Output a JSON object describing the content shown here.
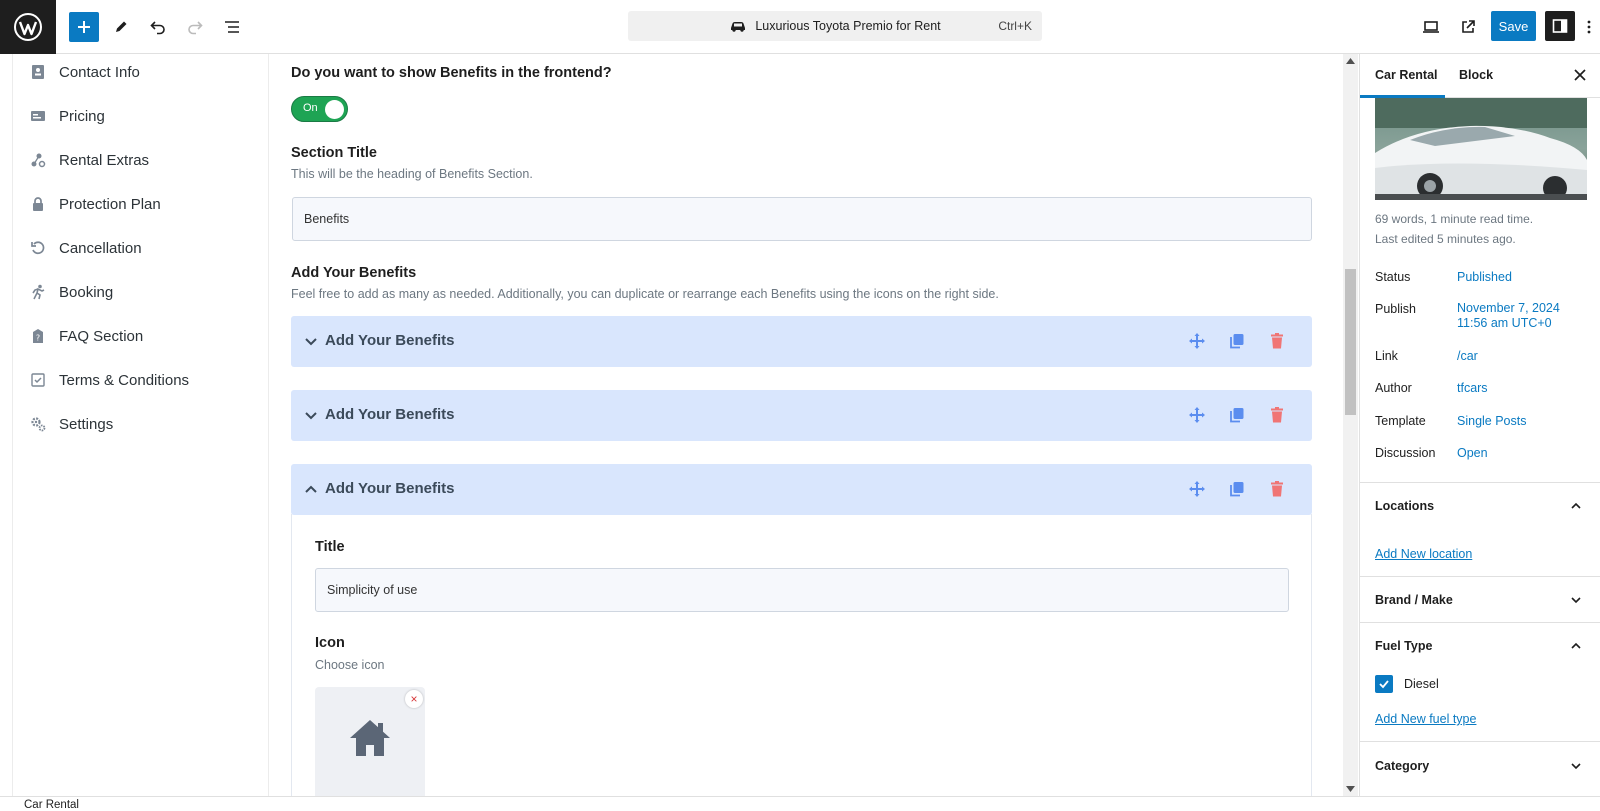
{
  "topbar": {
    "document_title": "Luxurious Toyota Premio for Rent",
    "shortcut": "Ctrl+K",
    "save_label": "Save"
  },
  "leftnav": {
    "items": [
      {
        "label": "Contact Info",
        "icon": "contact-card-icon"
      },
      {
        "label": "Pricing",
        "icon": "price-card-icon"
      },
      {
        "label": "Rental Extras",
        "icon": "extras-icon"
      },
      {
        "label": "Protection Plan",
        "icon": "lock-icon"
      },
      {
        "label": "Cancellation",
        "icon": "undo-icon"
      },
      {
        "label": "Booking",
        "icon": "booking-runner-icon"
      },
      {
        "label": "FAQ Section",
        "icon": "faq-icon"
      },
      {
        "label": "Terms & Conditions",
        "icon": "checklist-icon"
      },
      {
        "label": "Settings",
        "icon": "gears-icon"
      }
    ]
  },
  "main": {
    "show_question": "Do you want to show Benefits in the frontend?",
    "toggle_label": "On",
    "toggle_on": true,
    "section_title_label": "Section Title",
    "section_title_desc": "This will be the heading of Benefits Section.",
    "section_title_value": "Benefits",
    "benefits_label": "Add Your Benefits",
    "benefits_desc": "Feel free to add as many as needed. Additionally, you can duplicate or rearrange each Benefits using the icons on the right side.",
    "accordions": [
      {
        "title": "Add Your Benefits",
        "expanded": false
      },
      {
        "title": "Add Your Benefits",
        "expanded": false
      },
      {
        "title": "Add Your Benefits",
        "expanded": true
      }
    ],
    "item": {
      "title_label": "Title",
      "title_value": "Simplicity of use",
      "icon_label": "Icon",
      "icon_desc": "Choose icon",
      "icon_remove": "×",
      "selected_icon": "home-icon"
    }
  },
  "sidebar": {
    "tab_post": "Car Rental",
    "tab_block": "Block",
    "stats": "69 words, 1 minute read time.",
    "last_edited": "Last edited 5 minutes ago.",
    "rows": [
      {
        "label": "Status",
        "value": "Published"
      },
      {
        "label": "Publish",
        "value": "November 7, 2024",
        "value2": "11:56 am UTC+0"
      },
      {
        "label": "Link",
        "value": "/car"
      },
      {
        "label": "Author",
        "value": "tfcars"
      },
      {
        "label": "Template",
        "value": "Single Posts"
      },
      {
        "label": "Discussion",
        "value": "Open"
      }
    ],
    "locations_title": "Locations",
    "locations_link": "Add New location",
    "brand_title": "Brand / Make",
    "fuel_title": "Fuel Type",
    "fuel_option": "Diesel",
    "fuel_checked": true,
    "fuel_link": "Add New fuel type",
    "category_title": "Category"
  },
  "footer": {
    "breadcrumb": "Car Rental"
  },
  "colors": {
    "accent": "#0a7ac2",
    "toggle_on": "#1ea454",
    "accordion_bg": "#d9e6fd",
    "delete": "#f07575",
    "action_blue": "#5b8def"
  }
}
